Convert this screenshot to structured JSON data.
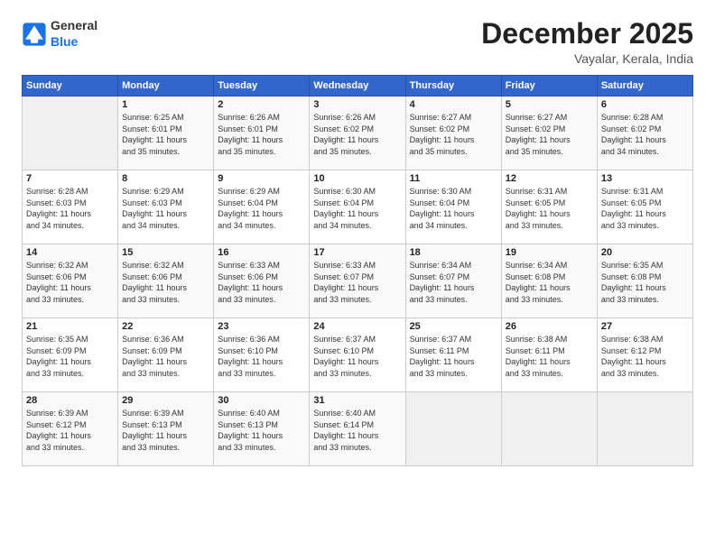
{
  "logo": {
    "text_general": "General",
    "text_blue": "Blue"
  },
  "header": {
    "month": "December 2025",
    "location": "Vayalar, Kerala, India"
  },
  "weekdays": [
    "Sunday",
    "Monday",
    "Tuesday",
    "Wednesday",
    "Thursday",
    "Friday",
    "Saturday"
  ],
  "weeks": [
    [
      {
        "day": "",
        "empty": true
      },
      {
        "day": "1",
        "sunrise": "6:25 AM",
        "sunset": "6:01 PM",
        "daylight": "11 hours and 35 minutes."
      },
      {
        "day": "2",
        "sunrise": "6:26 AM",
        "sunset": "6:01 PM",
        "daylight": "11 hours and 35 minutes."
      },
      {
        "day": "3",
        "sunrise": "6:26 AM",
        "sunset": "6:02 PM",
        "daylight": "11 hours and 35 minutes."
      },
      {
        "day": "4",
        "sunrise": "6:27 AM",
        "sunset": "6:02 PM",
        "daylight": "11 hours and 35 minutes."
      },
      {
        "day": "5",
        "sunrise": "6:27 AM",
        "sunset": "6:02 PM",
        "daylight": "11 hours and 35 minutes."
      },
      {
        "day": "6",
        "sunrise": "6:28 AM",
        "sunset": "6:02 PM",
        "daylight": "11 hours and 34 minutes."
      }
    ],
    [
      {
        "day": "7",
        "sunrise": "6:28 AM",
        "sunset": "6:03 PM",
        "daylight": "11 hours and 34 minutes."
      },
      {
        "day": "8",
        "sunrise": "6:29 AM",
        "sunset": "6:03 PM",
        "daylight": "11 hours and 34 minutes."
      },
      {
        "day": "9",
        "sunrise": "6:29 AM",
        "sunset": "6:04 PM",
        "daylight": "11 hours and 34 minutes."
      },
      {
        "day": "10",
        "sunrise": "6:30 AM",
        "sunset": "6:04 PM",
        "daylight": "11 hours and 34 minutes."
      },
      {
        "day": "11",
        "sunrise": "6:30 AM",
        "sunset": "6:04 PM",
        "daylight": "11 hours and 34 minutes."
      },
      {
        "day": "12",
        "sunrise": "6:31 AM",
        "sunset": "6:05 PM",
        "daylight": "11 hours and 33 minutes."
      },
      {
        "day": "13",
        "sunrise": "6:31 AM",
        "sunset": "6:05 PM",
        "daylight": "11 hours and 33 minutes."
      }
    ],
    [
      {
        "day": "14",
        "sunrise": "6:32 AM",
        "sunset": "6:06 PM",
        "daylight": "11 hours and 33 minutes."
      },
      {
        "day": "15",
        "sunrise": "6:32 AM",
        "sunset": "6:06 PM",
        "daylight": "11 hours and 33 minutes."
      },
      {
        "day": "16",
        "sunrise": "6:33 AM",
        "sunset": "6:06 PM",
        "daylight": "11 hours and 33 minutes."
      },
      {
        "day": "17",
        "sunrise": "6:33 AM",
        "sunset": "6:07 PM",
        "daylight": "11 hours and 33 minutes."
      },
      {
        "day": "18",
        "sunrise": "6:34 AM",
        "sunset": "6:07 PM",
        "daylight": "11 hours and 33 minutes."
      },
      {
        "day": "19",
        "sunrise": "6:34 AM",
        "sunset": "6:08 PM",
        "daylight": "11 hours and 33 minutes."
      },
      {
        "day": "20",
        "sunrise": "6:35 AM",
        "sunset": "6:08 PM",
        "daylight": "11 hours and 33 minutes."
      }
    ],
    [
      {
        "day": "21",
        "sunrise": "6:35 AM",
        "sunset": "6:09 PM",
        "daylight": "11 hours and 33 minutes."
      },
      {
        "day": "22",
        "sunrise": "6:36 AM",
        "sunset": "6:09 PM",
        "daylight": "11 hours and 33 minutes."
      },
      {
        "day": "23",
        "sunrise": "6:36 AM",
        "sunset": "6:10 PM",
        "daylight": "11 hours and 33 minutes."
      },
      {
        "day": "24",
        "sunrise": "6:37 AM",
        "sunset": "6:10 PM",
        "daylight": "11 hours and 33 minutes."
      },
      {
        "day": "25",
        "sunrise": "6:37 AM",
        "sunset": "6:11 PM",
        "daylight": "11 hours and 33 minutes."
      },
      {
        "day": "26",
        "sunrise": "6:38 AM",
        "sunset": "6:11 PM",
        "daylight": "11 hours and 33 minutes."
      },
      {
        "day": "27",
        "sunrise": "6:38 AM",
        "sunset": "6:12 PM",
        "daylight": "11 hours and 33 minutes."
      }
    ],
    [
      {
        "day": "28",
        "sunrise": "6:39 AM",
        "sunset": "6:12 PM",
        "daylight": "11 hours and 33 minutes."
      },
      {
        "day": "29",
        "sunrise": "6:39 AM",
        "sunset": "6:13 PM",
        "daylight": "11 hours and 33 minutes."
      },
      {
        "day": "30",
        "sunrise": "6:40 AM",
        "sunset": "6:13 PM",
        "daylight": "11 hours and 33 minutes."
      },
      {
        "day": "31",
        "sunrise": "6:40 AM",
        "sunset": "6:14 PM",
        "daylight": "11 hours and 33 minutes."
      },
      {
        "day": "",
        "empty": true
      },
      {
        "day": "",
        "empty": true
      },
      {
        "day": "",
        "empty": true
      }
    ]
  ],
  "labels": {
    "sunrise_prefix": "Sunrise: ",
    "sunset_prefix": "Sunset: ",
    "daylight_prefix": "Daylight: "
  }
}
